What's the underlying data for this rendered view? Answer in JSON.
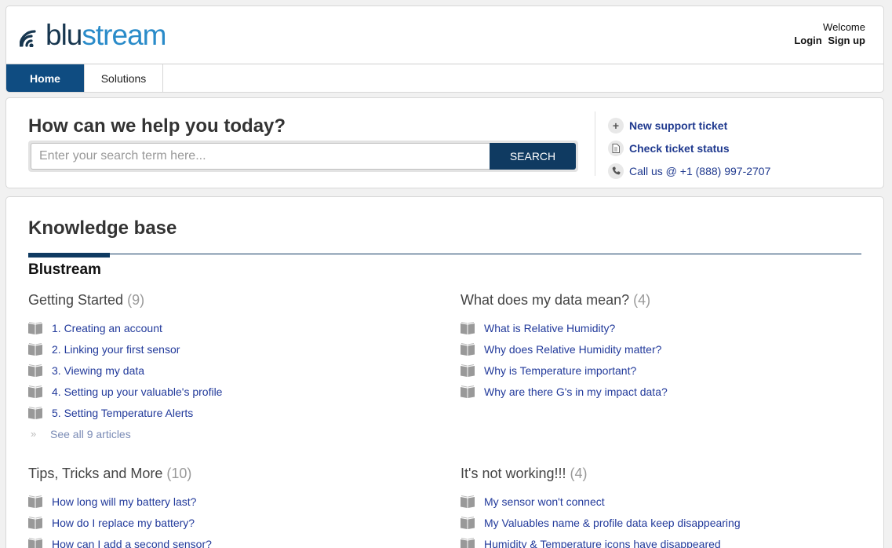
{
  "header": {
    "logo": {
      "part1": "blu",
      "part2": "stream"
    },
    "welcome": "Welcome",
    "login": "Login",
    "signup": "Sign up"
  },
  "nav": {
    "tabs": [
      {
        "label": "Home",
        "active": true
      },
      {
        "label": "Solutions",
        "active": false
      }
    ]
  },
  "search": {
    "title": "How can we help you today?",
    "placeholder": "Enter your search term here...",
    "button": "SEARCH"
  },
  "actions": [
    {
      "icon": "plus-icon",
      "label": "New support ticket"
    },
    {
      "icon": "document-icon",
      "label": "Check ticket status"
    },
    {
      "icon": "phone-icon",
      "label": "Call us @ +1 (888) 997-2707"
    }
  ],
  "kb": {
    "title": "Knowledge base",
    "category": "Blustream",
    "folders": [
      {
        "title": "Getting Started",
        "count": "(9)",
        "articles": [
          "1. Creating an account",
          "2. Linking your first sensor",
          "3. Viewing my data",
          "4. Setting up your valuable's profile",
          "5. Setting Temperature Alerts"
        ],
        "see_all": "See all 9 articles"
      },
      {
        "title": "What does my data mean?",
        "count": "(4)",
        "articles": [
          "What is Relative Humidity?",
          "Why does Relative Humidity matter?",
          "Why is Temperature important?",
          "Why are there G's in my impact data?"
        ]
      },
      {
        "title": "Tips, Tricks and More",
        "count": "(10)",
        "articles": [
          "How long will my battery last?",
          "How do I replace my battery?",
          "How can I add a second sensor?"
        ]
      },
      {
        "title": "It's not working!!!",
        "count": "(4)",
        "articles": [
          "My sensor won't connect",
          "My Valuables name & profile data keep disappearing",
          "Humidity & Temperature icons have disappeared"
        ]
      }
    ]
  }
}
